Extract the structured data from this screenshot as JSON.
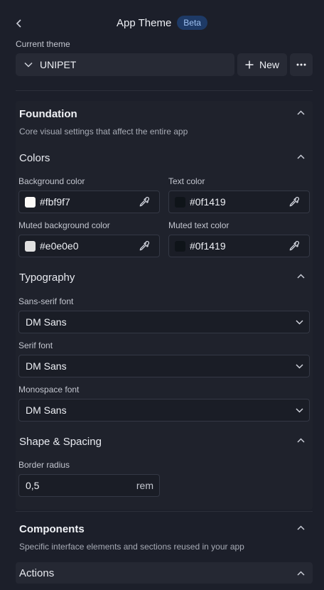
{
  "header": {
    "title": "App Theme",
    "badge": "Beta"
  },
  "current_theme": {
    "label": "Current theme",
    "value": "UNIPET",
    "new_label": "New"
  },
  "foundation": {
    "title": "Foundation",
    "description": "Core visual settings that affect the entire app",
    "colors": {
      "title": "Colors",
      "fields": [
        {
          "label": "Background color",
          "value": "#fbf9f7",
          "swatch": "#fbf9f7"
        },
        {
          "label": "Text color",
          "value": "#0f1419",
          "swatch": "#0f1419"
        },
        {
          "label": "Muted background color",
          "value": "#e0e0e0",
          "swatch": "#e0e0e0"
        },
        {
          "label": "Muted text color",
          "value": "#0f1419",
          "swatch": "#0f1419"
        }
      ]
    },
    "typography": {
      "title": "Typography",
      "fields": [
        {
          "label": "Sans-serif font",
          "value": "DM Sans"
        },
        {
          "label": "Serif font",
          "value": "DM Sans"
        },
        {
          "label": "Monospace font",
          "value": "DM Sans"
        }
      ]
    },
    "shape": {
      "title": "Shape & Spacing",
      "border_radius_label": "Border radius",
      "border_radius_value": "0,5",
      "border_radius_unit": "rem"
    }
  },
  "components": {
    "title": "Components",
    "description": "Specific interface elements and sections reused in your app",
    "actions_label": "Actions"
  },
  "icons": [
    "chevron-left-icon",
    "chevron-down-icon",
    "plus-icon",
    "more-horizontal-icon",
    "chevron-up-icon",
    "eyedropper-icon"
  ],
  "colors": {
    "background": "#1c1f2a",
    "badge_bg": "#1e3a66",
    "badge_text": "#9fc2f2"
  }
}
